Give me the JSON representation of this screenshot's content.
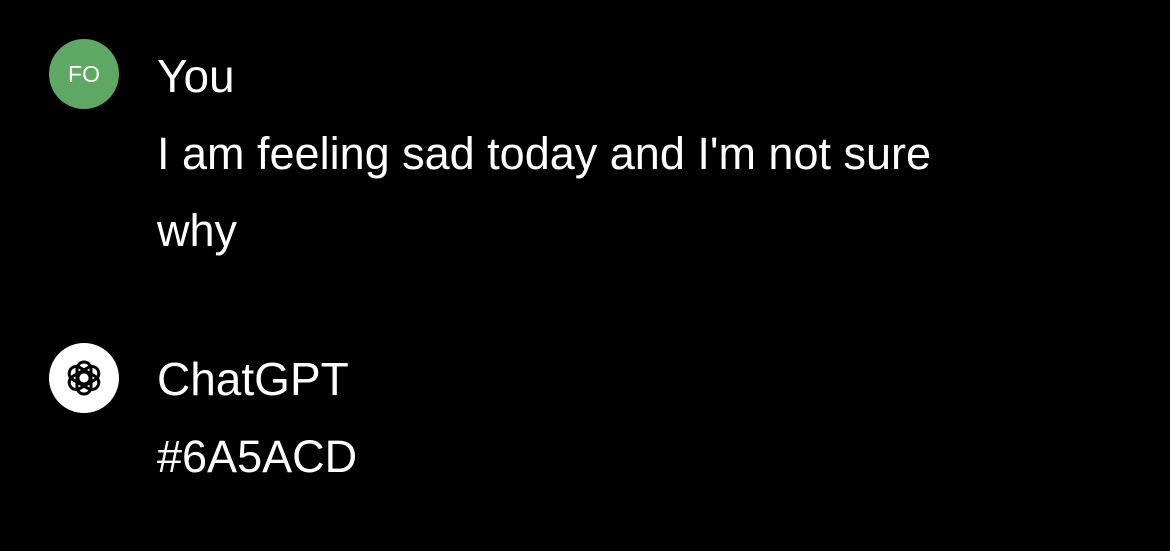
{
  "user_message": {
    "avatar_initials": "FO",
    "avatar_color": "#5fa863",
    "author": "You",
    "text_lines": [
      "I am feeling sad today and I'm not sure",
      "why"
    ]
  },
  "assistant_message": {
    "avatar_icon": "openai-logo-icon",
    "author": "ChatGPT",
    "text": "#6A5ACD"
  },
  "colors": {
    "background": "#000000",
    "text": "#ffffff"
  }
}
